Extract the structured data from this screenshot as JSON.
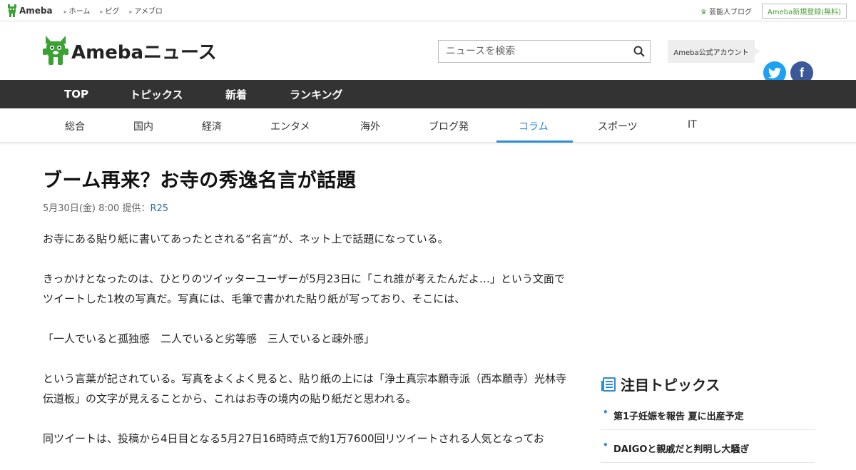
{
  "topbar": {
    "brand": "Ameba",
    "links": [
      "ホーム",
      "ピグ",
      "アメブロ"
    ],
    "celeb_blog": "芸能人ブログ",
    "register": "Ameba新規登録(無料)"
  },
  "header": {
    "logo_text": "Amebaニュース",
    "search_placeholder": "ニュースを検索",
    "official_account": "Ameba公式アカウント"
  },
  "main_nav": [
    "TOP",
    "トピックス",
    "新着",
    "ランキング"
  ],
  "category_nav": {
    "items": [
      "総合",
      "国内",
      "経済",
      "エンタメ",
      "海外",
      "ブログ発",
      "コラム",
      "スポーツ",
      "IT"
    ],
    "active": "コラム"
  },
  "article": {
    "title": "ブーム再来？お寺の秀逸名言が話題",
    "date": "5月30日(金) 8:00",
    "source_label": "提供：",
    "source": "R25",
    "paragraphs": [
      "お寺にある貼り紙に書いてあったとされる“名言”が、ネット上で話題になっている。",
      "きっかけとなったのは、ひとりのツイッターユーザーが5月23日に「これ誰が考えたんだよ…」という文面でツイートした1枚の写真だ。写真には、毛筆で書かれた貼り紙が写っており、そこには、",
      "「一人でいると孤独感　二人でいると劣等感　三人でいると疎外感」",
      "という言葉が記されている。写真をよくよく見ると、貼り紙の上には「浄土真宗本願寺派（西本願寺）光林寺　伝道板」の文字が見えることから、これはお寺の境内の貼り紙だと思われる。",
      "同ツイートは、投稿から4日目となる5月27日16時時点で約1万7600回リツイートされる人気となってお"
    ]
  },
  "sidebar": {
    "heading": "注目トピックス",
    "items": [
      "第1子妊娠を報告 夏に出産予定",
      "DAIGOと親戚だと判明し大騒ぎ"
    ]
  },
  "colors": {
    "brand_green": "#3aa133",
    "accent_blue": "#2e8bd6",
    "nav_dark": "#333333",
    "twitter": "#1da1f2",
    "facebook": "#3b5998"
  }
}
